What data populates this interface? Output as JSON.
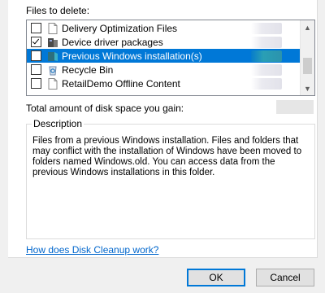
{
  "dialog": {
    "files_label": "Files to delete:",
    "items": [
      {
        "label": "Delivery Optimization Files",
        "checked": false,
        "selected": false,
        "icon": "document-icon"
      },
      {
        "label": "Device driver packages",
        "checked": true,
        "selected": false,
        "icon": "driver-package-icon"
      },
      {
        "label": "Previous Windows installation(s)",
        "checked": false,
        "selected": true,
        "icon": "windows-install-icon"
      },
      {
        "label": "Recycle Bin",
        "checked": false,
        "selected": false,
        "icon": "recycle-bin-icon"
      },
      {
        "label": "RetailDemo Offline Content",
        "checked": false,
        "selected": false,
        "icon": "document-icon"
      }
    ],
    "total_label": "Total amount of disk space you gain:",
    "description_title": "Description",
    "description_text": "Files from a previous Windows installation.  Files and folders that may conflict with the installation of Windows have been moved to folders named Windows.old.  You can access data from the previous Windows installations in this folder.",
    "help_link": "How does Disk Cleanup work?",
    "ok_label": "OK",
    "cancel_label": "Cancel",
    "selection_color": "#0078d7",
    "link_color": "#0066cc"
  }
}
